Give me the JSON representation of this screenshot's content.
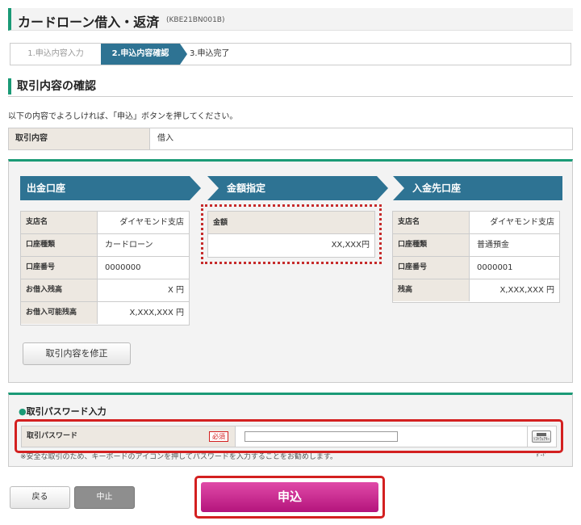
{
  "header": {
    "title": "カードローン借入・返済",
    "code": "(KBE21BN001B)"
  },
  "steps": [
    "1.申込内容入力",
    "2.申込内容確認",
    "3.申込完了"
  ],
  "section_title": "取引内容の確認",
  "lead_text": "以下の内容でよろしければ、「申込」ボタンを押してください。",
  "transaction": {
    "label": "取引内容",
    "value": "借入"
  },
  "panels": {
    "source": {
      "title": "出金口座",
      "rows": [
        {
          "k": "支店名",
          "v": "ダイヤモンド支店"
        },
        {
          "k": "口座種類",
          "v": "カードローン"
        },
        {
          "k": "口座番号",
          "v": "0000000"
        },
        {
          "k": "お借入残高",
          "v": "X 円"
        },
        {
          "k": "お借入可能残高",
          "v": "X,XXX,XXX 円"
        }
      ]
    },
    "amount": {
      "title": "金額指定",
      "label": "金額",
      "value": "XX,XXX円"
    },
    "dest": {
      "title": "入金先口座",
      "rows": [
        {
          "k": "支店名",
          "v": "ダイヤモンド支店"
        },
        {
          "k": "口座種類",
          "v": "普通預金"
        },
        {
          "k": "口座番号",
          "v": "0000001"
        },
        {
          "k": "残高",
          "v": "X,XXX,XXX 円"
        }
      ]
    }
  },
  "edit_button": "取引内容を修正",
  "password": {
    "title": "取引パスワード入力",
    "label": "取引パスワード",
    "required": "必須",
    "keyboard_icon_text": "ｿﾌﾄｳｪｱｷｰﾎﾞｰﾄﾞ",
    "note": "※安全な取引のため、キーボードのアイコンを押してパスワードを入力することをお勧めします。"
  },
  "buttons": {
    "back": "戻る",
    "stop": "中止",
    "submit": "申込"
  },
  "colors": {
    "accent": "#1a9a76",
    "panel_header": "#2e7393",
    "highlight": "#d32020",
    "submit": "#c21a8a"
  }
}
